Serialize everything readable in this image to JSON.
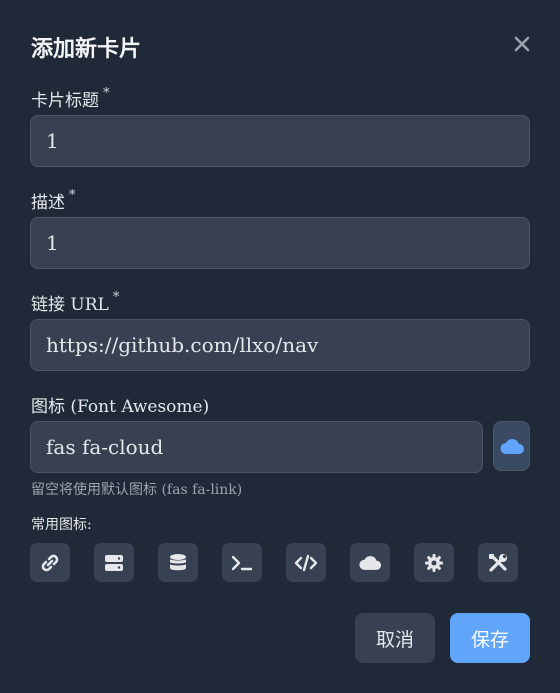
{
  "dialog": {
    "title": "添加新卡片"
  },
  "fields": {
    "title_label": "卡片标题",
    "title_value": "1",
    "desc_label": "描述",
    "desc_value": "1",
    "url_label": "链接 URL",
    "url_value": "https://github.com/llxo/nav",
    "icon_label": "图标 (Font Awesome)",
    "icon_value": "fas fa-cloud",
    "required_mark": "*",
    "icon_hint": "留空将使用默认图标 (fas fa-link)"
  },
  "common_icons": {
    "label": "常用图标:",
    "items": [
      "link-icon",
      "server-icon",
      "database-icon",
      "terminal-icon",
      "code-icon",
      "cloud-icon",
      "gear-icon",
      "tools-icon"
    ]
  },
  "buttons": {
    "cancel": "取消",
    "save": "保存"
  },
  "colors": {
    "background": "#1f2937",
    "input": "#374151",
    "accent": "#60a5fa"
  }
}
